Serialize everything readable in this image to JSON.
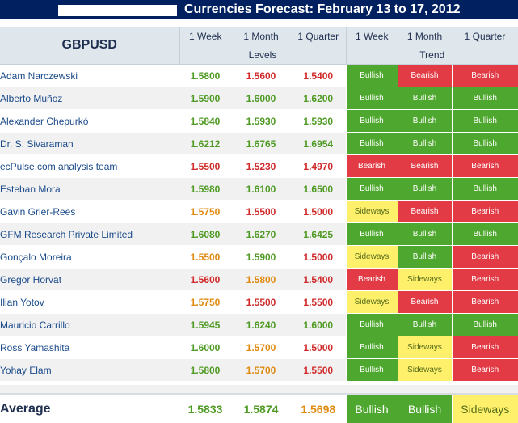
{
  "title": "Currencies Forecast: February 13 to 17, 2012",
  "pair": "GBPUSD",
  "header": {
    "periods": [
      "1 Week",
      "1 Month",
      "1 Quarter"
    ],
    "levels_label": "Levels",
    "trend_label": "Trend"
  },
  "colors": {
    "title_bg": "#002060",
    "header_bg": "#dfe6ec",
    "bullish": "#4ea72e",
    "bearish": "#e23b45",
    "sideways": "#fef06b",
    "level_green": "#4e9a23",
    "level_red": "#d02a2a",
    "level_orange": "#e08a10"
  },
  "rows": [
    {
      "name": "Adam Narczewski",
      "levels": [
        "1.5800",
        "1.5600",
        "1.5400"
      ],
      "level_colors": [
        "green",
        "red",
        "red"
      ],
      "trends": [
        "Bullish",
        "Bearish",
        "Bearish"
      ]
    },
    {
      "name": "Alberto Muñoz",
      "levels": [
        "1.5900",
        "1.6000",
        "1.6200"
      ],
      "level_colors": [
        "green",
        "green",
        "green"
      ],
      "trends": [
        "Bullish",
        "Bullish",
        "Bullish"
      ]
    },
    {
      "name": "Alexander Chepurkó",
      "levels": [
        "1.5840",
        "1.5930",
        "1.5930"
      ],
      "level_colors": [
        "green",
        "green",
        "green"
      ],
      "trends": [
        "Bullish",
        "Bullish",
        "Bullish"
      ]
    },
    {
      "name": "Dr. S. Sivaraman",
      "levels": [
        "1.6212",
        "1.6765",
        "1.6954"
      ],
      "level_colors": [
        "green",
        "green",
        "green"
      ],
      "trends": [
        "Bullish",
        "Bullish",
        "Bullish"
      ]
    },
    {
      "name": "ecPulse.com analysis team",
      "levels": [
        "1.5500",
        "1.5230",
        "1.4970"
      ],
      "level_colors": [
        "red",
        "red",
        "red"
      ],
      "trends": [
        "Bearish",
        "Bearish",
        "Bearish"
      ]
    },
    {
      "name": "Esteban Mora",
      "levels": [
        "1.5980",
        "1.6100",
        "1.6500"
      ],
      "level_colors": [
        "green",
        "green",
        "green"
      ],
      "trends": [
        "Bullish",
        "Bullish",
        "Bullish"
      ]
    },
    {
      "name": "Gavin Grier-Rees",
      "levels": [
        "1.5750",
        "1.5500",
        "1.5000"
      ],
      "level_colors": [
        "orange",
        "red",
        "red"
      ],
      "trends": [
        "Sideways",
        "Bearish",
        "Bearish"
      ]
    },
    {
      "name": "GFM Research Private Limited",
      "levels": [
        "1.6080",
        "1.6270",
        "1.6425"
      ],
      "level_colors": [
        "green",
        "green",
        "green"
      ],
      "trends": [
        "Bullish",
        "Bullish",
        "Bullish"
      ]
    },
    {
      "name": "Gonçalo Moreira",
      "levels": [
        "1.5500",
        "1.5900",
        "1.5000"
      ],
      "level_colors": [
        "orange",
        "green",
        "red"
      ],
      "trends": [
        "Sideways",
        "Bullish",
        "Bearish"
      ]
    },
    {
      "name": "Gregor Horvat",
      "levels": [
        "1.5600",
        "1.5800",
        "1.5400"
      ],
      "level_colors": [
        "red",
        "orange",
        "red"
      ],
      "trends": [
        "Bearish",
        "Sideways",
        "Bearish"
      ]
    },
    {
      "name": "Ilian Yotov",
      "levels": [
        "1.5750",
        "1.5500",
        "1.5500"
      ],
      "level_colors": [
        "orange",
        "red",
        "red"
      ],
      "trends": [
        "Sideways",
        "Bearish",
        "Bearish"
      ]
    },
    {
      "name": "Mauricio Carrillo",
      "levels": [
        "1.5945",
        "1.6240",
        "1.6000"
      ],
      "level_colors": [
        "green",
        "green",
        "green"
      ],
      "trends": [
        "Bullish",
        "Bullish",
        "Bullish"
      ]
    },
    {
      "name": "Ross Yamashita",
      "levels": [
        "1.6000",
        "1.5700",
        "1.5000"
      ],
      "level_colors": [
        "green",
        "orange",
        "red"
      ],
      "trends": [
        "Bullish",
        "Sideways",
        "Bearish"
      ]
    },
    {
      "name": "Yohay Elam",
      "levels": [
        "1.5800",
        "1.5700",
        "1.5500"
      ],
      "level_colors": [
        "green",
        "orange",
        "red"
      ],
      "trends": [
        "Bullish",
        "Sideways",
        "Bearish"
      ]
    }
  ],
  "average": {
    "label": "Average",
    "levels": [
      "1.5833",
      "1.5874",
      "1.5698"
    ],
    "level_colors": [
      "green",
      "green",
      "orange"
    ],
    "trends": [
      "Bullish",
      "Bullish",
      "Sideways"
    ]
  }
}
